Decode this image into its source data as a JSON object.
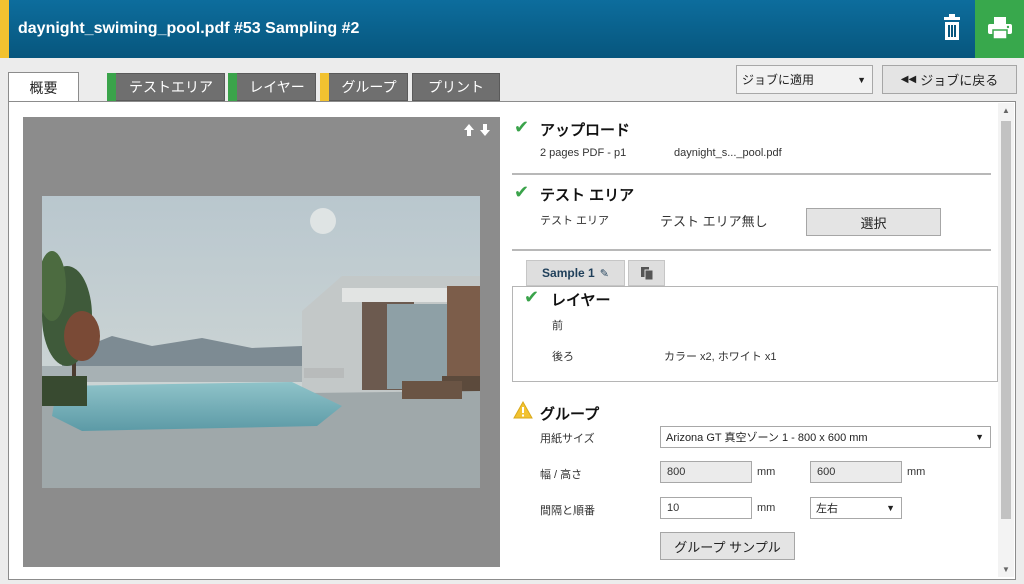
{
  "header": {
    "title": "daynight_swiming_pool.pdf #53 Sampling #2",
    "accent_color": "#f2c230",
    "trash_icon": "trash-icon",
    "print_icon": "printer-icon"
  },
  "tabs": [
    {
      "label": "概要",
      "marker": ""
    },
    {
      "label": "テストエリア",
      "marker": "#3aa34a"
    },
    {
      "label": "レイヤー",
      "marker": "#3aa34a"
    },
    {
      "label": "グループ",
      "marker": "#f2c230"
    },
    {
      "label": "プリント",
      "marker": ""
    }
  ],
  "job_select": {
    "value": "ジョブに適用"
  },
  "back_button": {
    "label": "ジョブに戻る"
  },
  "preview": {
    "arrows": "🡑🡓"
  },
  "upload": {
    "title": "アップロード",
    "pages": "2 pages PDF - p1",
    "file": "daynight_s..._pool.pdf"
  },
  "test_area": {
    "title": "テスト エリア",
    "label": "テスト エリア",
    "value": "テスト エリア無し",
    "select_button": "選択"
  },
  "sample_tab": {
    "label": "Sample 1"
  },
  "layers": {
    "title": "レイヤー",
    "front_label": "前",
    "back_label": "後ろ",
    "back_value": "カラー x2, ホワイト x1"
  },
  "group": {
    "title": "グループ",
    "paper_size_label": "用紙サイズ",
    "paper_size_value": "Arizona GT 真空ゾーン 1 - 800 x 600 mm",
    "wh_label": "幅 / 高さ",
    "width_value": "800",
    "height_value": "600",
    "unit": "mm",
    "spacing_label": "間隔と順番",
    "spacing_value": "10",
    "order_value": "左右",
    "sample_button": "グループ サンプル"
  }
}
